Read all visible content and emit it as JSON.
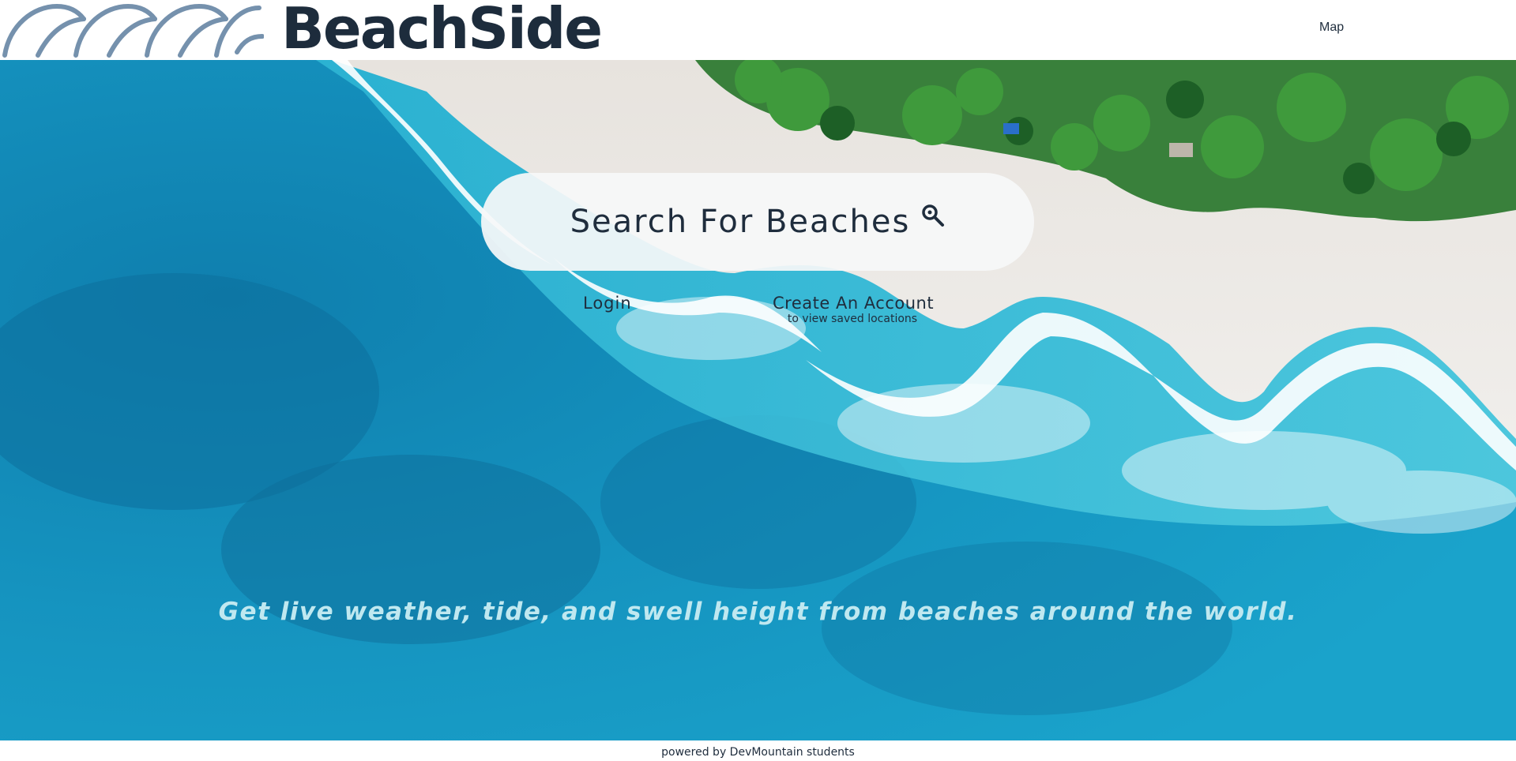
{
  "header": {
    "brand": "BeachSide",
    "logo_icon": "waves-icon",
    "nav": {
      "map_label": "Map"
    }
  },
  "hero": {
    "search_label": "Search For Beaches",
    "search_icon": "search-icon",
    "login_label": "Login",
    "create_account_label": "Create An Account",
    "create_account_sub": "to view saved locations",
    "tagline": "Get live weather, tide, and swell height from beaches around the world."
  },
  "footer": {
    "text": "powered by DevMountain students"
  },
  "colors": {
    "brand_dark": "#1d2c3c",
    "wave_blue": "#7591ad",
    "ocean": "#1a9fc6",
    "sand": "#eceae6",
    "tagline": "#bfe8f0"
  }
}
